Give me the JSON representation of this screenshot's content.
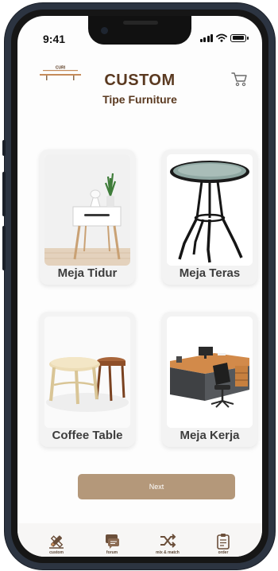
{
  "status_bar": {
    "time": "9:41"
  },
  "header": {
    "logo_text": "CURI",
    "title": "CUSTOM",
    "subtitle": "Tipe Furniture"
  },
  "colors": {
    "accent": "#b4987a",
    "title": "#5a3920",
    "label": "#3d3d3d"
  },
  "categories": [
    {
      "label": "Meja Tidur",
      "icon": "nightstand-image"
    },
    {
      "label": "Meja Teras",
      "icon": "patio-table-image"
    },
    {
      "label": "Coffee Table",
      "icon": "coffee-table-image"
    },
    {
      "label": "Meja Kerja",
      "icon": "work-desk-image"
    }
  ],
  "next_button": {
    "label": "Next"
  },
  "tabs": [
    {
      "label": "custom",
      "icon": "pencil-ruler-icon",
      "active": true
    },
    {
      "label": "forum",
      "icon": "chat-icon",
      "active": false
    },
    {
      "label": "mix & match",
      "icon": "shuffle-icon",
      "active": false
    },
    {
      "label": "order",
      "icon": "clipboard-icon",
      "active": false
    }
  ]
}
